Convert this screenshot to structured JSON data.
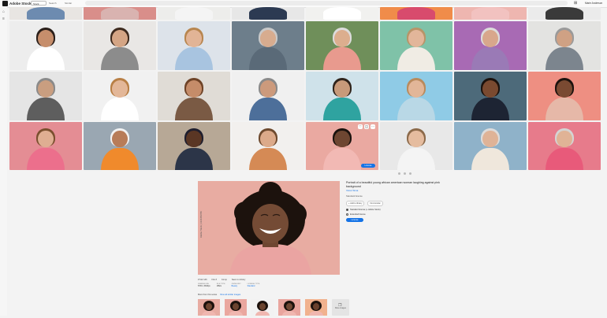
{
  "topbar": {
    "logo": "Adobe Stock",
    "filter_select": "Stock",
    "search_tool": "Search",
    "similar_tool": "Similar",
    "user": "Marie Anderson"
  },
  "grid": {
    "tiles": [
      {
        "bg": "#e8e5e2",
        "skin": "#c99a7e",
        "hair": "#3b2a1f",
        "shirt": "#6d8bb0"
      },
      {
        "bg": "#d98e8a",
        "skin": "#e1b08f",
        "hair": "#5a3b2a",
        "shirt": "#d9b3b0"
      },
      {
        "bg": "#ededeb",
        "skin": "#d9ae8f",
        "hair": "#3a2a20",
        "shirt": "#f4f4f4"
      },
      {
        "bg": "#e7e7e7",
        "skin": "#c7977a",
        "hair": "#2a2a2a",
        "shirt": "#2c3a52"
      },
      {
        "bg": "#f1f1ef",
        "skin": "#d2a384",
        "hair": "#2b211c",
        "shirt": "#ffffff"
      },
      {
        "bg": "#f08c4a",
        "skin": "#8a5a3e",
        "hair": "#1f1410",
        "shirt": "#d84b6d"
      },
      {
        "bg": "#eeb6b0",
        "skin": "#e4b99c",
        "hair": "#5c3f2b",
        "shirt": "#f2c2c0"
      },
      {
        "bg": "#ebebeb",
        "skin": "#caa084",
        "hair": "#333",
        "shirt": "#3a3a3a"
      },
      {
        "bg": "#ededed",
        "skin": "#c68e6c",
        "hair": "#2a1f1a",
        "shirt": "#ffffff"
      },
      {
        "bg": "#e9e7e5",
        "skin": "#d4a585",
        "hair": "#3d2a1e",
        "shirt": "#8c8c8c"
      },
      {
        "bg": "#dde3ea",
        "skin": "#e2b496",
        "hair": "#b8864f",
        "shirt": "#a8c4e0"
      },
      {
        "bg": "#6d7e8b",
        "skin": "#d7ac8f",
        "hair": "#c9c9c9",
        "shirt": "#5a6a78"
      },
      {
        "bg": "#6f8f5a",
        "skin": "#dcae8e",
        "hair": "#dcdcdc",
        "shirt": "#e89a8e"
      },
      {
        "bg": "#7fc2a8",
        "skin": "#e2b69a",
        "hair": "#b89468",
        "shirt": "#f0ece4"
      },
      {
        "bg": "#a86ab4",
        "skin": "#d8a78c",
        "hair": "#dcdcdc",
        "shirt": "#9a7ab6"
      },
      {
        "bg": "#e3e3e1",
        "skin": "#cfa184",
        "hair": "#9a9a9a",
        "shirt": "#7c858e"
      },
      {
        "bg": "#e5e5e5",
        "skin": "#c99e80",
        "hair": "#8a8a8a",
        "shirt": "#5e5e5e"
      },
      {
        "bg": "#f1f1f1",
        "skin": "#e3b798",
        "hair": "#b87f45",
        "shirt": "#ffffff"
      },
      {
        "bg": "#e0dcd6",
        "skin": "#c58c69",
        "hair": "#6e4327",
        "shirt": "#7a5a44"
      },
      {
        "bg": "#f0f0f0",
        "skin": "#cc9a7c",
        "hair": "#8a8a8a",
        "shirt": "#4d6f9a"
      },
      {
        "bg": "#cfe2ea",
        "skin": "#c89a7a",
        "hair": "#2f231b",
        "shirt": "#2fa3a0"
      },
      {
        "bg": "#8fcbe6",
        "skin": "#e2b698",
        "hair": "#b98a5c",
        "shirt": "#b9d8e6"
      },
      {
        "bg": "#4d6a7a",
        "skin": "#7a4a30",
        "hair": "#1b120d",
        "shirt": "#1d2433"
      },
      {
        "bg": "#ee8f82",
        "skin": "#7a4a32",
        "hair": "#1c120e",
        "shirt": "#e6b8a8"
      },
      {
        "bg": "#e48d94",
        "skin": "#dfae92",
        "hair": "#7a4f2e",
        "shirt": "#ec6f8c"
      },
      {
        "bg": "#9aa7b2",
        "skin": "#b87c58",
        "hair": "#f2f2f2",
        "shirt": "#f08a2c"
      },
      {
        "bg": "#b7a896",
        "skin": "#5a3624",
        "hair": "#1e1e2e",
        "shirt": "#2c3548"
      },
      {
        "bg": "#f2f0ee",
        "skin": "#dcaa8a",
        "hair": "#6e4a2e",
        "shirt": "#d58a55"
      },
      {
        "bg": "#eaa9a1",
        "skin": "#6e4631",
        "hair": "#1a120d",
        "shirt": "#f2b9b4"
      },
      {
        "bg": "#e8e8e8",
        "skin": "#e5bc9f",
        "hair": "#8c6a4a",
        "shirt": "#f4f4f4"
      },
      {
        "bg": "#8fb2c9",
        "skin": "#dfb397",
        "hair": "#dcdcdc",
        "shirt": "#efe7dc"
      },
      {
        "bg": "#e77b8b",
        "skin": "#e0b396",
        "hair": "#d4d4d4",
        "shirt": "#e85a7a"
      }
    ],
    "hover_license": "License"
  },
  "detail": {
    "watermark": "Adobe Stock | #123456789",
    "title": "Portrait of a beautiful young african american woman laughing against pink background",
    "author": "Viorel Sima",
    "license_type": "Standard license",
    "add_library": "+ Add to library",
    "find_similar": "Find similar",
    "radio_standard": "Standard license (+ Adobe Stock)",
    "radio_extended": "Extended license",
    "license_button": "License",
    "meta_file": "# 612 146",
    "meta_file_sub": "File #",
    "meta_collection": "Comp",
    "meta_save": "Save to Library",
    "col1_k": "DIMENSIONS",
    "col1_v": "5760 x 3840px",
    "col2_k": "FILE TYPE",
    "col2_v": "JPEG",
    "col3_k": "CATEGORY",
    "col3_v": "Beauty",
    "col4_k": "LICENSE TYPE",
    "col4_v": "Standard",
    "more_label": "More from this series",
    "more_link": "View all similar images",
    "thumbs": [
      {
        "bg": "#e8aca2",
        "skin": "#6e4631"
      },
      {
        "bg": "#eaa79f",
        "skin": "#6b432f"
      },
      {
        "bg": "#f2f2f2",
        "skin": "#6a432e"
      },
      {
        "bg": "#e9a59e",
        "skin": "#6f4733"
      },
      {
        "bg": "#f1b28e",
        "skin": "#6a412d"
      }
    ],
    "more_thumb": "More images"
  }
}
